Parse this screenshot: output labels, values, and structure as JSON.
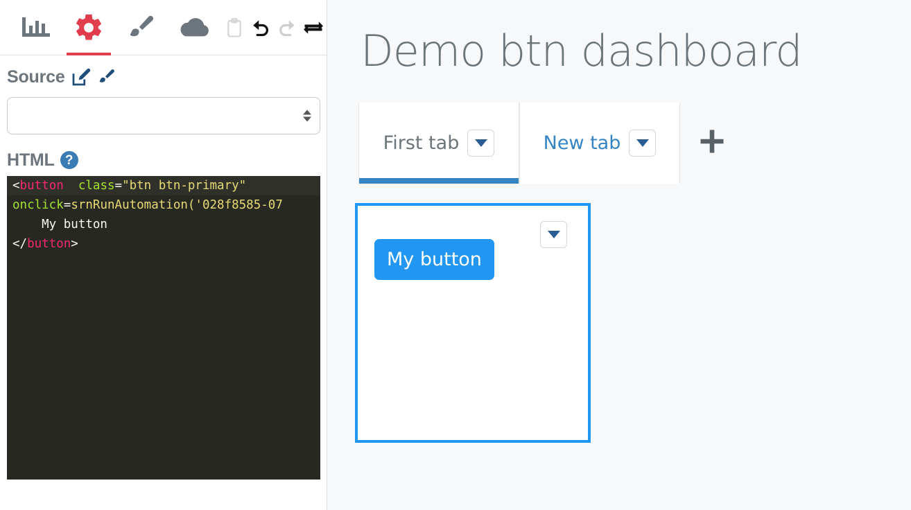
{
  "sidebar": {
    "toolbar": [
      {
        "name": "chart-icon",
        "label": "Chart",
        "active": false,
        "disabled": false
      },
      {
        "name": "gear-icon",
        "label": "Settings",
        "active": true,
        "disabled": false
      },
      {
        "name": "paintbrush-icon",
        "label": "Style",
        "active": false,
        "disabled": false
      },
      {
        "name": "cloud-icon",
        "label": "Cloud",
        "active": false,
        "disabled": false
      },
      {
        "name": "clipboard-icon",
        "label": "Paste",
        "active": false,
        "disabled": true
      },
      {
        "name": "undo-icon",
        "label": "Undo",
        "active": false,
        "disabled": false
      },
      {
        "name": "redo-icon",
        "label": "Redo",
        "active": false,
        "disabled": true
      },
      {
        "name": "swap-icon",
        "label": "Swap",
        "active": false,
        "disabled": false
      }
    ],
    "source": {
      "label": "Source",
      "edit_icon": "edit-square-icon",
      "brush_icon": "paintbrush-icon",
      "select_value": "",
      "select_placeholder": ""
    },
    "html": {
      "label": "HTML",
      "help_icon": "question-circle-icon",
      "help_label": "?",
      "code_lines": [
        {
          "active": true,
          "tokens": [
            {
              "t": "punct",
              "v": "<"
            },
            {
              "t": "tag",
              "v": "button"
            },
            {
              "t": "text",
              "v": "  "
            },
            {
              "t": "attr",
              "v": "class"
            },
            {
              "t": "punct",
              "v": "="
            },
            {
              "t": "str",
              "v": "\"btn btn-primary\""
            }
          ]
        },
        {
          "active": false,
          "tokens": [
            {
              "t": "attr",
              "v": "onclick"
            },
            {
              "t": "punct",
              "v": "="
            },
            {
              "t": "str",
              "v": "srnRunAutomation('028f8585-07"
            }
          ]
        },
        {
          "active": false,
          "tokens": [
            {
              "t": "text",
              "v": "    My button"
            }
          ]
        },
        {
          "active": false,
          "tokens": [
            {
              "t": "punct",
              "v": "</"
            },
            {
              "t": "tag",
              "v": "button"
            },
            {
              "t": "punct",
              "v": ">"
            }
          ]
        }
      ]
    }
  },
  "main": {
    "title": "Demo btn dashboard",
    "tabs": [
      {
        "label": "First tab",
        "active": true,
        "caret_icon": "chevron-down-icon"
      },
      {
        "label": "New tab",
        "active": false,
        "caret_icon": "chevron-down-icon"
      }
    ],
    "add_tab_icon": "plus-icon",
    "widget": {
      "button_label": "My button",
      "menu_icon": "chevron-down-icon"
    }
  },
  "colors": {
    "accent_red": "#e03e4e",
    "tab_blue": "#3585c3",
    "widget_blue": "#2196f3",
    "icon_gray": "#6c757d",
    "title_gray": "#6b7479",
    "code_bg": "#272822",
    "help_blue": "#3b7cb4",
    "source_icon_blue": "#1f4e79"
  }
}
